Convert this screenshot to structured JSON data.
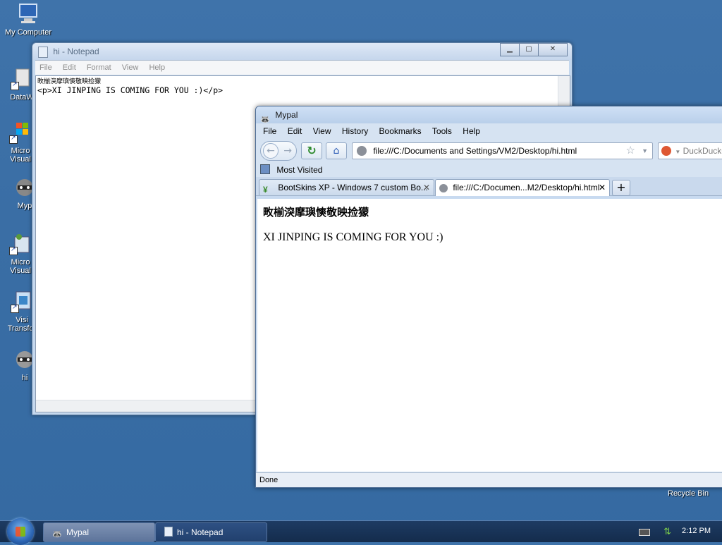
{
  "desktop": {
    "icons": [
      {
        "label": "My Computer",
        "icon": "computer-icon"
      },
      {
        "label": "DataW",
        "icon": "shortcut-icon"
      },
      {
        "label": "Micro",
        "label2": "Visual",
        "icon": "shortcut-icon"
      },
      {
        "label": "Myp",
        "icon": "raccoon-icon"
      },
      {
        "label": "Micro",
        "label2": "Visual",
        "icon": "shortcut-icon"
      },
      {
        "label": "Visi",
        "label2": "Transfor",
        "icon": "shortcut-icon"
      },
      {
        "label": "hi",
        "icon": "raccoon-icon"
      }
    ],
    "recycle_bin": "Recycle Bin"
  },
  "notepad": {
    "title": "hi - Notepad",
    "menu": [
      "File",
      "Edit",
      "Format",
      "View",
      "Help"
    ],
    "content_line1": "畋椾湥摩璵慡敬映捡獴",
    "content_line2": "<p>XI JINPING IS COMING FOR YOU :)</p>"
  },
  "mypal": {
    "title": "Mypal",
    "menu": [
      "File",
      "Edit",
      "View",
      "History",
      "Bookmarks",
      "Tools",
      "Help"
    ],
    "url": "file:///C:/Documents and Settings/VM2/Desktop/hi.html",
    "search_placeholder": "DuckDuckGo",
    "bookmark": "Most Visited",
    "tabs": [
      {
        "label": "BootSkins XP - Windows 7 custom Bo...",
        "active": false
      },
      {
        "label": "file:///C:/Documen...M2/Desktop/hi.html",
        "active": true
      }
    ],
    "new_tab": "+",
    "page_heading": "畋椾湥摩璵慡敬映捡獴",
    "page_paragraph": "XI JINPING IS COMING FOR YOU :)",
    "status": "Done"
  },
  "taskbar": {
    "items": [
      "Mypal",
      "hi - Notepad"
    ],
    "clock": "2:12 PM"
  }
}
